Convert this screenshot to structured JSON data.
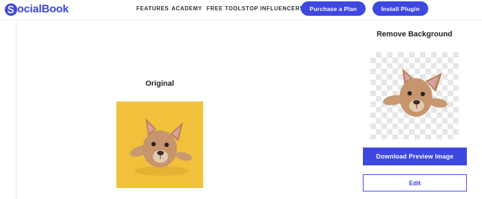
{
  "brand": {
    "name": "ocialBook",
    "accent": "#3e48e0"
  },
  "nav": {
    "links": [
      "FEATURES",
      "ACADEMY",
      "FREE TOOLS",
      "TOP INFLUENCERS"
    ],
    "purchase_label": "Purchase a Plan",
    "install_label": "Install Plugin"
  },
  "original": {
    "title": "Original",
    "background_color": "#f2c13b"
  },
  "result": {
    "title": "Remove Background"
  },
  "actions": {
    "download_label": "Download Preview Image",
    "edit_label": "Edit"
  }
}
